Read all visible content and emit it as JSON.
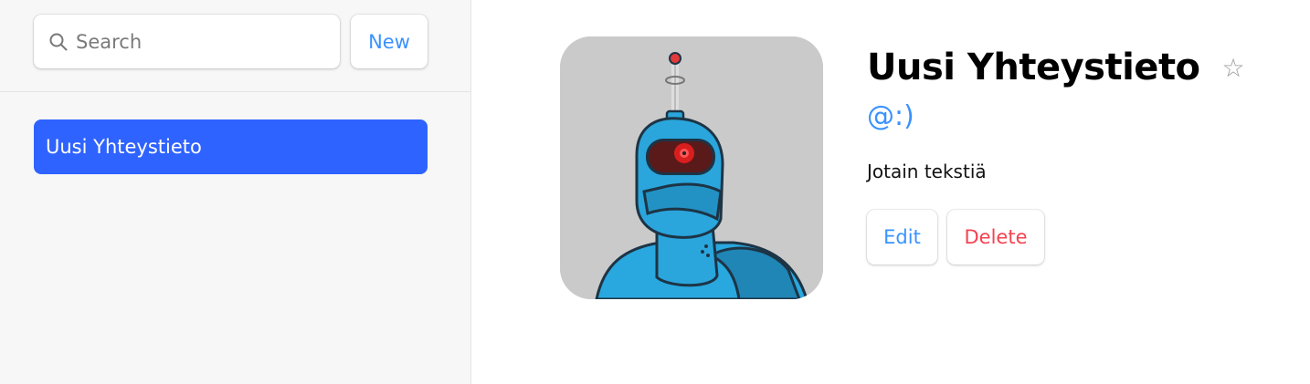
{
  "sidebar": {
    "search": {
      "placeholder": "Search",
      "value": ""
    },
    "new_label": "New",
    "contacts": [
      {
        "label": "Uusi Yhteystieto",
        "active": true
      }
    ]
  },
  "contact": {
    "name": "Uusi Yhteystieto",
    "favorite_icon": "☆",
    "handle": "@:)",
    "notes": "Jotain tekstiä",
    "edit_label": "Edit",
    "delete_label": "Delete",
    "avatar_icon": "robot-avatar"
  },
  "colors": {
    "accent": "#3992ff",
    "active_item": "#2f63ff",
    "danger": "#f44250",
    "sidebar_bg": "#f7f7f7"
  }
}
